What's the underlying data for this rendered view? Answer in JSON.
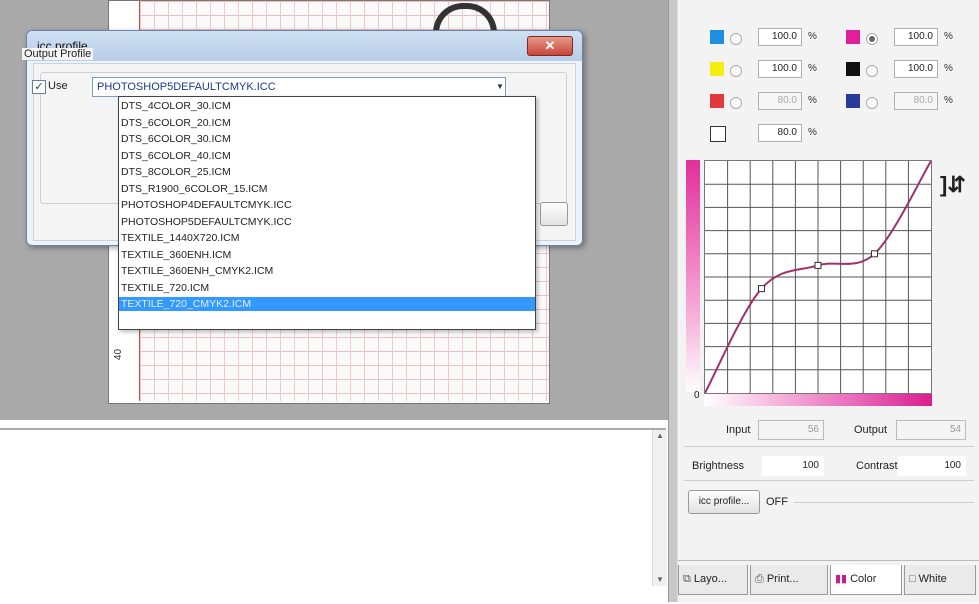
{
  "dialog": {
    "title": "icc profile",
    "close_glyph": "✕",
    "group_label": "Output Profile",
    "use_label": "Use",
    "use_checked": true,
    "selected_profile": "PHOTOSHOP5DEFAULTCMYK.ICC",
    "options": [
      "DTS_4COLOR_30.ICM",
      "DTS_6COLOR_20.ICM",
      "DTS_6COLOR_30.ICM",
      "DTS_6COLOR_40.ICM",
      "DTS_8COLOR_25.ICM",
      "DTS_R1900_6COLOR_15.ICM",
      "PHOTOSHOP4DEFAULTCMYK.ICC",
      "PHOTOSHOP5DEFAULTCMYK.ICC",
      "TEXTILE_1440X720.ICM",
      "TEXTILE_360ENH.ICM",
      "TEXTILE_360ENH_CMYK2.ICM",
      "TEXTILE_720.ICM",
      "TEXTILE_720_CMYK2.ICM"
    ],
    "highlighted_index": 12
  },
  "canvas": {
    "ruler_label": "40"
  },
  "panel": {
    "channels": [
      {
        "color": "#1e8fe0",
        "value": "100.0",
        "enabled": true,
        "selected": false
      },
      {
        "color": "#e0209a",
        "value": "100.0",
        "enabled": true,
        "selected": true
      },
      {
        "color": "#f5ec10",
        "value": "100.0",
        "enabled": true,
        "selected": false
      },
      {
        "color": "#111111",
        "value": "100.0",
        "enabled": true,
        "selected": false
      },
      {
        "color": "#e03a3a",
        "value": "80.0",
        "enabled": false,
        "selected": false
      },
      {
        "color": "#2a3a9a",
        "value": "80.0",
        "enabled": false,
        "selected": false
      },
      {
        "color": "#ffffff",
        "value": "80.0",
        "enabled": true,
        "selected": false
      }
    ],
    "percent_sign": "%",
    "curve": {
      "axis_zero": "0",
      "control_points": [
        [
          0,
          0
        ],
        [
          25,
          45
        ],
        [
          50,
          55
        ],
        [
          75,
          60
        ],
        [
          100,
          100
        ]
      ],
      "bracket_glyph": "]⇵"
    },
    "input_label": "Input",
    "input_value": "56",
    "output_label": "Output",
    "output_value": "54",
    "brightness_label": "Brightness",
    "brightness_value": "100",
    "contrast_label": "Contrast",
    "contrast_value": "100",
    "icc_button": "icc profile...",
    "icc_state": "OFF",
    "tabs": [
      {
        "label": "Layo...",
        "icon": "layout-icon",
        "glyph": "⧉",
        "active": false
      },
      {
        "label": "Print...",
        "icon": "printer-icon",
        "glyph": "⎙",
        "active": false
      },
      {
        "label": "Color",
        "icon": "color-bars-icon",
        "glyph": "▮▮",
        "active": true
      },
      {
        "label": "White",
        "icon": "white-square-icon",
        "glyph": "□",
        "active": false
      }
    ]
  }
}
